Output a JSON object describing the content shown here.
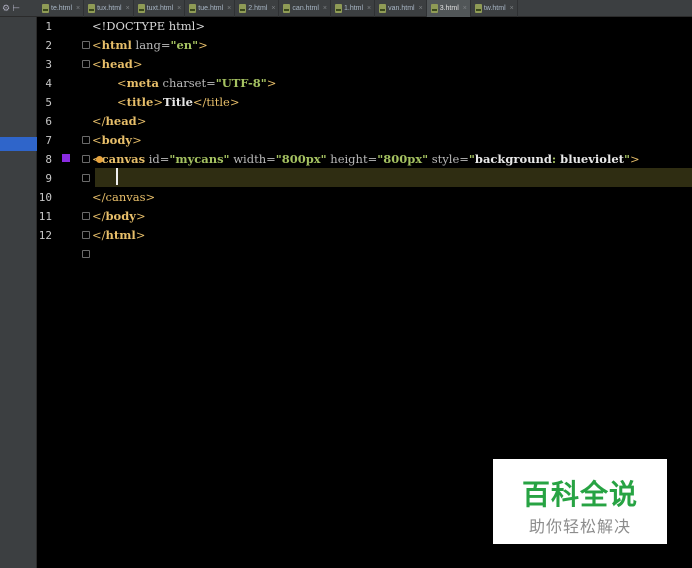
{
  "tabs": [
    {
      "label": "te.html",
      "active": false
    },
    {
      "label": "tux.html",
      "active": false
    },
    {
      "label": "tuxt.html",
      "active": false
    },
    {
      "label": "tue.html",
      "active": false
    },
    {
      "label": "2.html",
      "active": false
    },
    {
      "label": "can.html",
      "active": false
    },
    {
      "label": "1.html",
      "active": false
    },
    {
      "label": "van.html",
      "active": false
    },
    {
      "label": "3.html",
      "active": true
    },
    {
      "label": "tw.html",
      "active": false
    }
  ],
  "line_numbers": [
    "1",
    "2",
    "3",
    "4",
    "5",
    "6",
    "7",
    "8",
    "9",
    "10",
    "11",
    "12"
  ],
  "code": {
    "l1": "<!DOCTYPE html>",
    "l2": {
      "open": "<",
      "tag": "html",
      "attr": " lang=",
      "val": "\"en\"",
      "close": ">"
    },
    "l3": {
      "open": "<",
      "tag": "head",
      "close": ">"
    },
    "l4": {
      "open": "<",
      "tag": "meta",
      "attr": " charset=",
      "val": "\"UTF-8\"",
      "close": ">"
    },
    "l5": {
      "open": "<",
      "tag": "title",
      "close": ">",
      "text": "Title",
      "end": "</title>"
    },
    "l6": {
      "open": "</",
      "tag": "head",
      "close": ">"
    },
    "l7": {
      "open": "<",
      "tag": "body",
      "close": ">"
    },
    "l8": {
      "open": "<",
      "tag": "canvas",
      "a1": " id=",
      "v1": "\"mycans\"",
      "a2": " width=",
      "v2": "\"800px\"",
      "a3": " height=",
      "v3": "\"800px\"",
      "a4": " style=",
      "q1": "\"",
      "s1": "background",
      "s2": ": ",
      "s3": "blueviolet",
      "q2": "\"",
      "close": ">"
    },
    "l10": {
      "open": "</",
      "tag": "canvas",
      "close": ">"
    },
    "l11": {
      "open": "</",
      "tag": "body",
      "close": ">"
    },
    "l12": {
      "open": "</",
      "tag": "html",
      "close": ">"
    }
  },
  "watermark": {
    "title": "百科全说",
    "subtitle": "助你轻松解决"
  },
  "colors": {
    "bookmark": "#8a2be2",
    "watermark_green": "#27a343"
  }
}
